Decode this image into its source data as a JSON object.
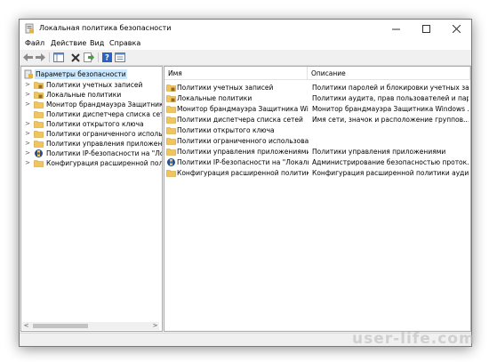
{
  "window": {
    "title": "Локальная политика безопасности"
  },
  "menu": [
    "Файл",
    "Действие",
    "Вид",
    "Справка"
  ],
  "toolbar": [
    "back-icon",
    "forward-icon",
    "show-hide-tree-icon",
    "delete-icon",
    "export-icon",
    "help-icon",
    "properties-icon"
  ],
  "tree": {
    "root": "Параметры безопасности",
    "items": [
      "Политики учетных записей",
      "Локальные политики",
      "Монитор брандмауэра Защитника Windows",
      "Политики диспетчера списка сетей",
      "Политики открытого ключа",
      "Политики ограниченного использования программ",
      "Политики управления приложениями",
      "Политики IP-безопасности на \"Локальный компьютер\"",
      "Конфигурация расширенной политики аудита"
    ]
  },
  "list": {
    "columns": [
      "Имя",
      "Описание"
    ],
    "rows": [
      {
        "name": "Политики учетных записей",
        "desc": "Политики паролей и блокировки учетных за..."
      },
      {
        "name": "Локальные политики",
        "desc": "Политики аудита, прав пользователей и пар..."
      },
      {
        "name": "Монитор брандмауэра Защитника Win...",
        "desc": "Монитор брандмауэра Защитника Windows ..."
      },
      {
        "name": "Политики диспетчера списка сетей",
        "desc": "Имя сети, значок и расположение группов..."
      },
      {
        "name": "Политики открытого ключа",
        "desc": ""
      },
      {
        "name": "Политики ограниченного использован...",
        "desc": ""
      },
      {
        "name": "Политики управления приложениями",
        "desc": "Политики управления приложениями"
      },
      {
        "name": "Политики IP-безопасности на \"Локаль...",
        "desc": "Администрирование безопасностью проток..."
      },
      {
        "name": "Конфигурация расширенной политик...",
        "desc": "Конфигурация расширенной политики аудита"
      }
    ]
  },
  "watermark": "user-life.com",
  "colors": {
    "selection": "#cce8ff",
    "folder": "#f2c55c"
  }
}
